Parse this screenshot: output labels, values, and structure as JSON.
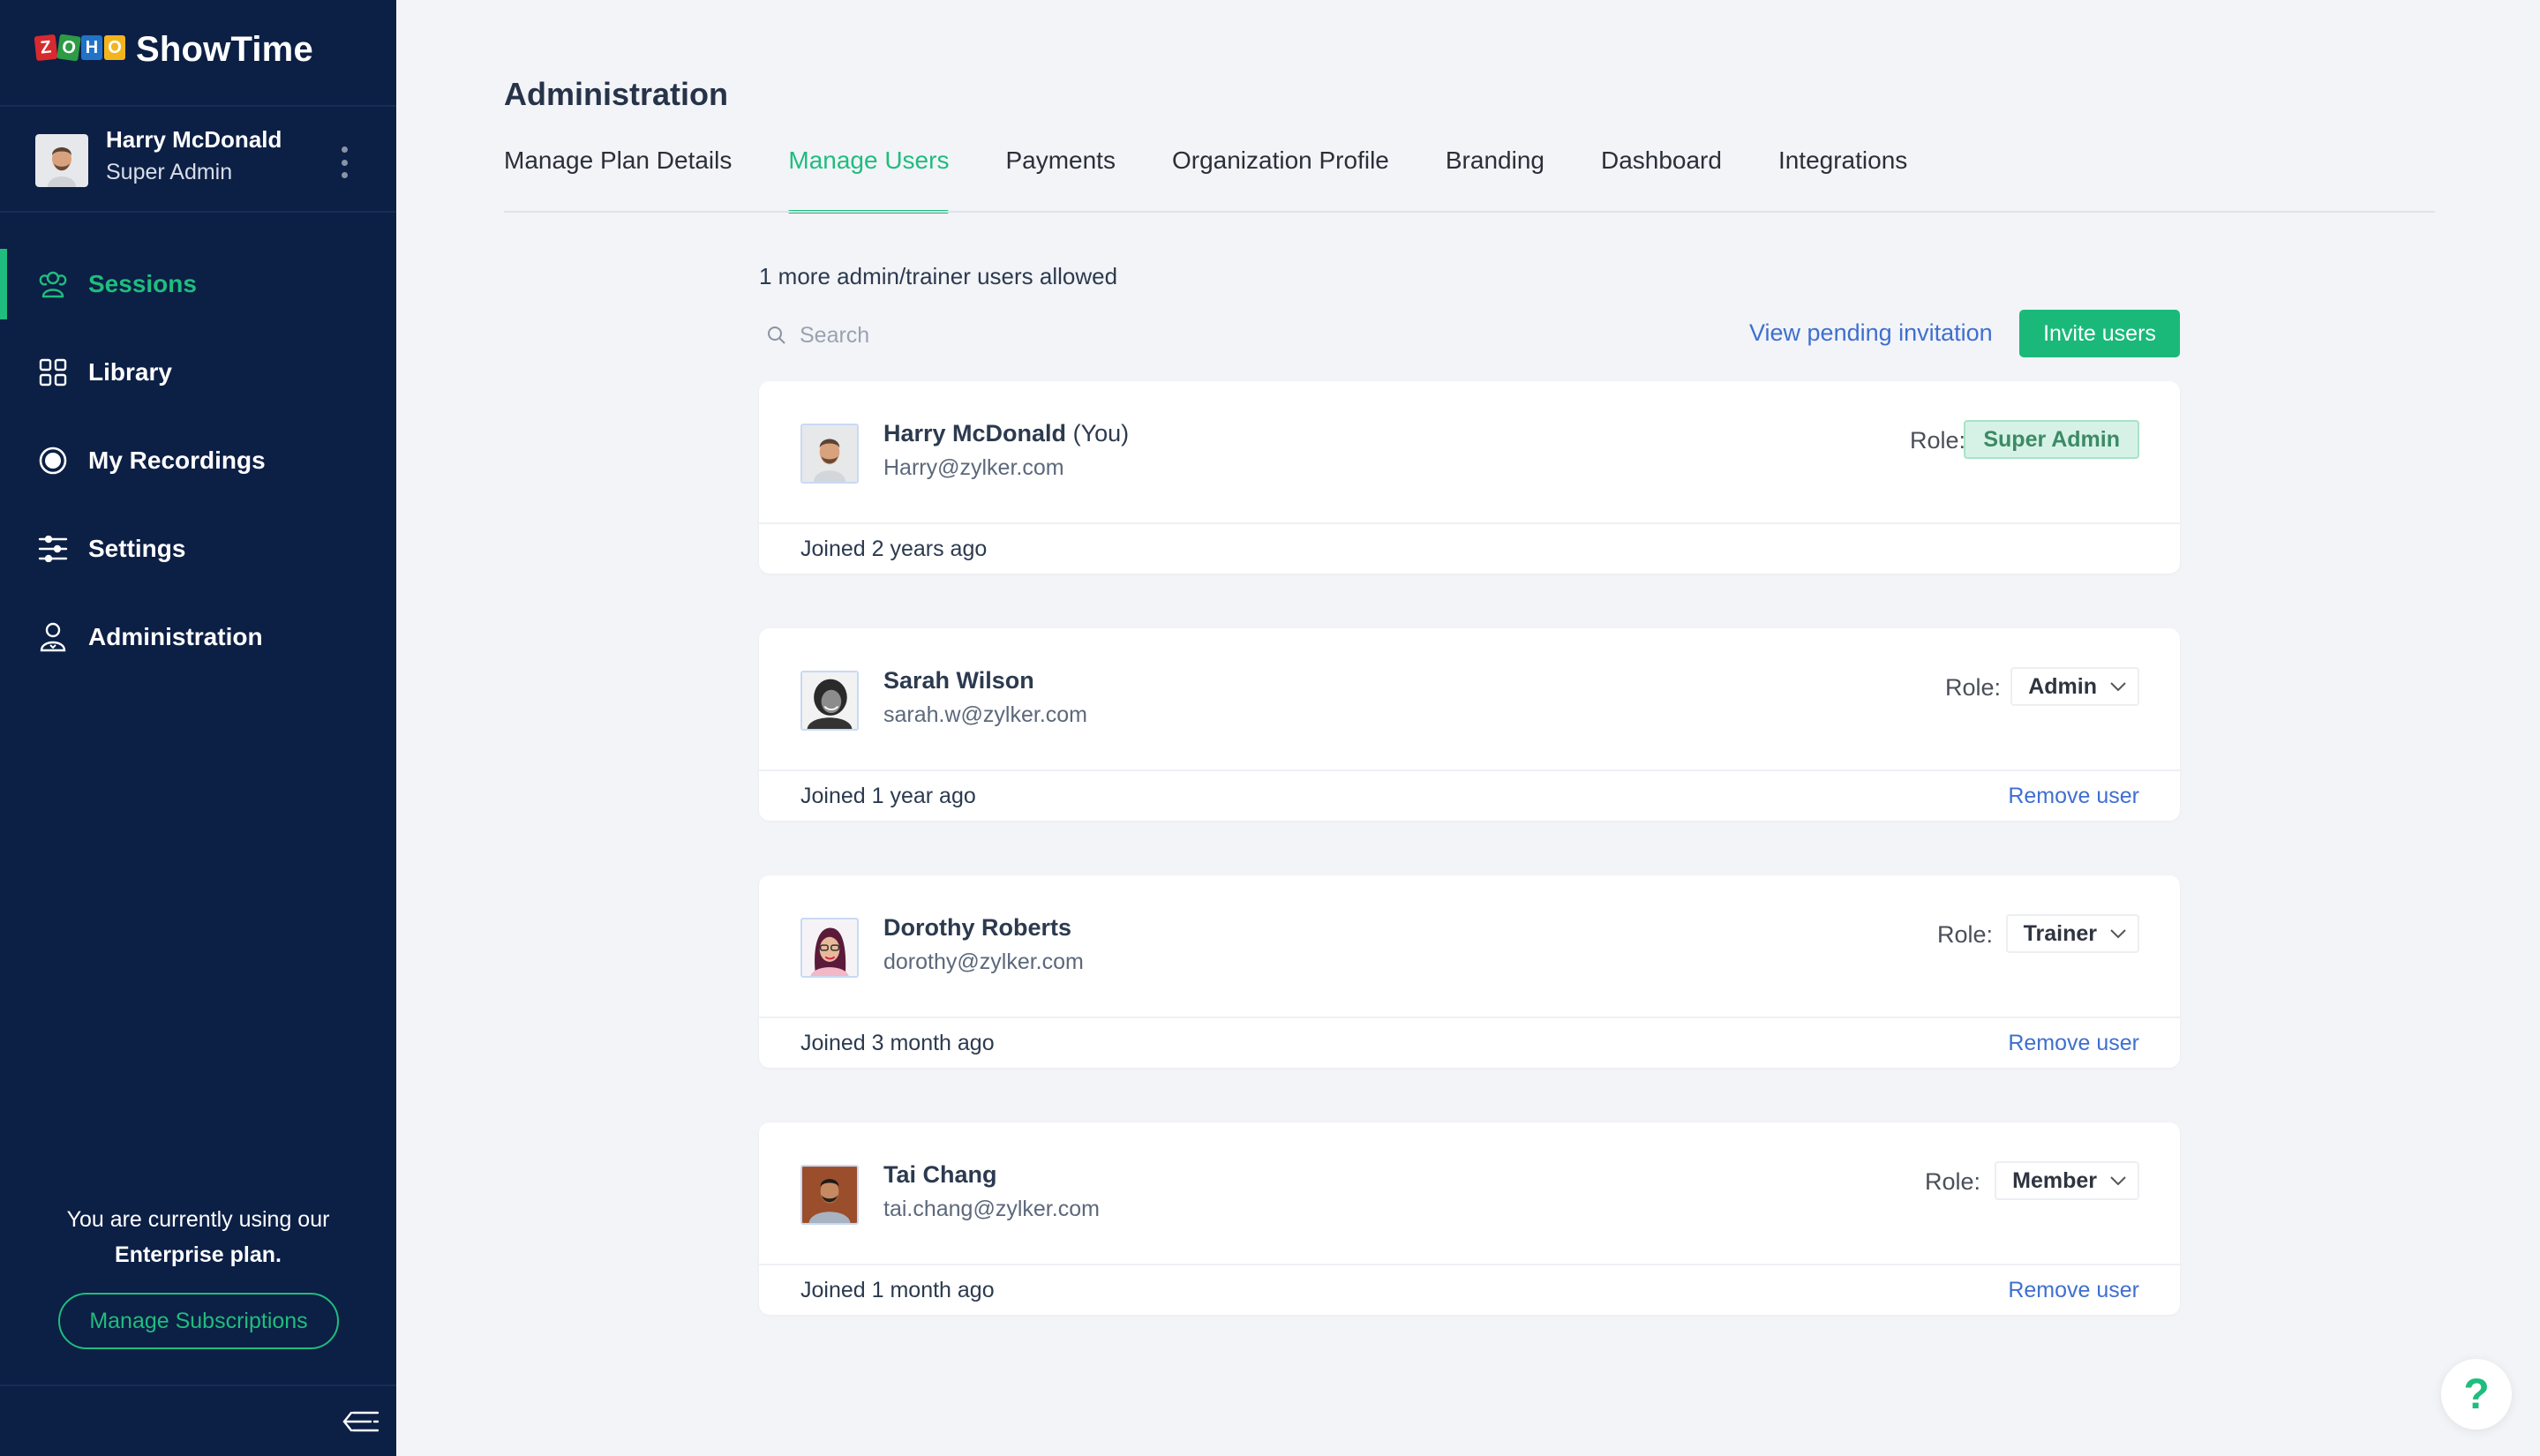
{
  "app": {
    "brand_logo": [
      "Z",
      "O",
      "H",
      "O"
    ],
    "brand_name": "ShowTime"
  },
  "sidebar": {
    "user": {
      "name": "Harry McDonald",
      "role": "Super Admin"
    },
    "items": [
      {
        "label": "Sessions",
        "icon": "sessions-icon",
        "active": true
      },
      {
        "label": "Library",
        "icon": "library-icon",
        "active": false
      },
      {
        "label": "My Recordings",
        "icon": "recordings-icon",
        "active": false
      },
      {
        "label": "Settings",
        "icon": "settings-icon",
        "active": false
      },
      {
        "label": "Administration",
        "icon": "administration-icon",
        "active": false
      }
    ],
    "plan_line1": "You are currently using our",
    "plan_line2": "Enterprise plan.",
    "manage_subscriptions": "Manage Subscriptions"
  },
  "header": {
    "title": "Administration",
    "tabs": [
      {
        "label": "Manage Plan Details",
        "active": false
      },
      {
        "label": "Manage Users",
        "active": true
      },
      {
        "label": "Payments",
        "active": false
      },
      {
        "label": "Organization Profile",
        "active": false
      },
      {
        "label": "Branding",
        "active": false
      },
      {
        "label": "Dashboard",
        "active": false
      },
      {
        "label": "Integrations",
        "active": false
      }
    ]
  },
  "users_panel": {
    "allowed_text": "1 more admin/trainer users allowed",
    "search_placeholder": "Search",
    "view_pending": "View pending invitation",
    "invite_button": "Invite users",
    "role_label": "Role:",
    "remove_label": "Remove user",
    "users": [
      {
        "name": "Harry McDonald",
        "you": "(You)",
        "email": "Harry@zylker.com",
        "role": "Super Admin",
        "role_editable": false,
        "joined": "Joined 2 years ago"
      },
      {
        "name": "Sarah Wilson",
        "you": "",
        "email": "sarah.w@zylker.com",
        "role": "Admin",
        "role_editable": true,
        "joined": "Joined 1 year ago"
      },
      {
        "name": "Dorothy Roberts",
        "you": "",
        "email": "dorothy@zylker.com",
        "role": "Trainer",
        "role_editable": true,
        "joined": "Joined 3 month ago"
      },
      {
        "name": "Tai Chang",
        "you": "",
        "email": "tai.chang@zylker.com",
        "role": "Member",
        "role_editable": true,
        "joined": "Joined 1 month ago"
      }
    ]
  },
  "help": {
    "icon": "help-icon",
    "glyph": "?"
  },
  "colors": {
    "sidebar_bg": "#0c1f45",
    "accent_green": "#1fbd7e",
    "link_blue": "#3f6fcf",
    "page_bg": "#f3f4f8"
  }
}
